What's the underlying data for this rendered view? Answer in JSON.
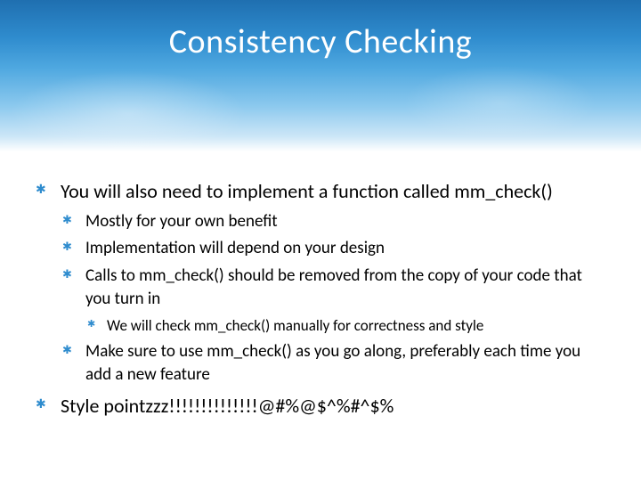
{
  "title": "Consistency Checking",
  "bullets": {
    "b1": "You will also need to implement a function called mm_check()",
    "b1_1": "Mostly for your own benefit",
    "b1_2": "Implementation will depend on your design",
    "b1_3": "Calls to mm_check() should be removed from the copy of your code that you turn in",
    "b1_3_1": "We will check mm_check() manually for correctness and style",
    "b1_4": "Make sure to use mm_check() as you go along, preferably each time you add a new feature",
    "b2": "Style pointzzz!!!!!!!!!!!!!!@#%@$^%#^$%"
  }
}
